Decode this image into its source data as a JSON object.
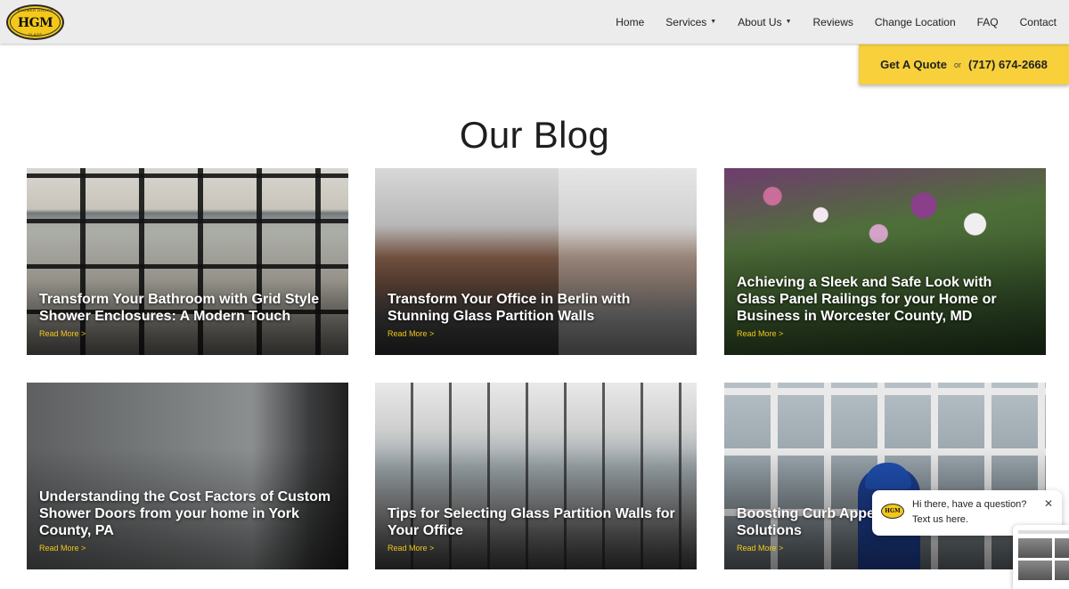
{
  "header": {
    "logo": {
      "main": "HGM",
      "arc_top": "SHOWER DOORS",
      "arc_bottom": "GLASS"
    },
    "nav": [
      {
        "label": "Home",
        "dropdown": false
      },
      {
        "label": "Services",
        "dropdown": true
      },
      {
        "label": "About Us",
        "dropdown": true
      },
      {
        "label": "Reviews",
        "dropdown": false
      },
      {
        "label": "Change Location",
        "dropdown": false
      },
      {
        "label": "FAQ",
        "dropdown": false
      },
      {
        "label": "Contact",
        "dropdown": false
      }
    ],
    "caret_icon": "chevron-down-icon"
  },
  "quote": {
    "cta": "Get A Quote",
    "or": "or",
    "phone": "(717) 674-2668",
    "color": "#f7d03b"
  },
  "main": {
    "title": "Our Blog",
    "cards": [
      {
        "title": "Transform Your Bathroom with Grid Style Shower Enclosures: A Modern Touch",
        "more": "Read More >"
      },
      {
        "title": "Transform Your Office in Berlin with Stunning Glass Partition Walls",
        "more": "Read More >"
      },
      {
        "title": "Achieving a Sleek and Safe Look with Glass Panel Railings for your Home or Business in Worcester County, MD",
        "more": "Read More >"
      },
      {
        "title": "Understanding the Cost Factors of Custom Shower Doors from your home in York County, PA",
        "more": "Read More >"
      },
      {
        "title": "Tips for Selecting Glass Partition Walls for Your Office",
        "more": "Read More >"
      },
      {
        "title": "Boosting Curb Appe",
        "title_line2": "Solutions",
        "more": "Read More >"
      }
    ]
  },
  "chat": {
    "line1": "Hi there, have a question?",
    "line2": "Text us here.",
    "logo": "HGM",
    "close": "✕"
  },
  "colors": {
    "accent": "#f3c81a",
    "header_bg": "#ececec"
  }
}
